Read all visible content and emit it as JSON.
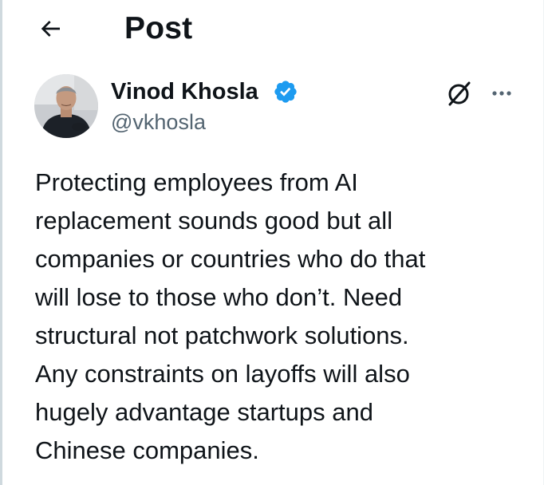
{
  "header": {
    "back_icon": "arrow-left-icon",
    "title": "Post"
  },
  "author": {
    "display_name": "Vinod Khosla",
    "handle": "@vkhosla",
    "verified_icon": "verified-badge-icon",
    "verified_color": "#1d9bf0"
  },
  "actions": {
    "grok_icon": "grok-icon",
    "more_icon": "more-horizontal-icon"
  },
  "post": {
    "lines": [
      "Protecting employees from AI",
      "replacement sounds good but all",
      "companies or countries who do that",
      "will lose to those who don’t. Need",
      "structural not patchwork solutions.",
      "Any constraints on layoffs will also",
      "hugely advantage startups and",
      "Chinese companies."
    ]
  },
  "colors": {
    "text": "#0f1419",
    "secondary": "#536471",
    "accent": "#1d9bf0"
  }
}
